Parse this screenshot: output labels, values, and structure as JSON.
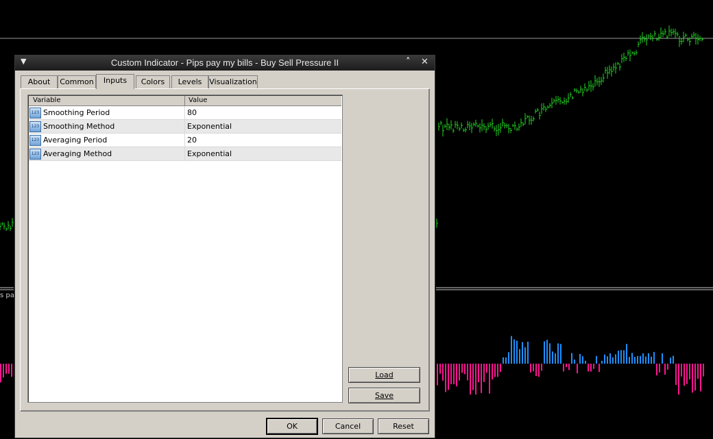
{
  "background": {
    "side_label": "s pay",
    "price_color": "#23d723",
    "up_color": "#1e90ff",
    "down_color": "#ff1493"
  },
  "dialog": {
    "title": "Custom Indicator - Pips pay my bills - Buy Sell Pressure II",
    "menu_icon": "dropdown-arrow-icon",
    "maximize_icon": "chevron-up-icon",
    "close_icon": "close-icon",
    "tabs": [
      {
        "label": "About"
      },
      {
        "label": "Common"
      },
      {
        "label": "Inputs",
        "active": true
      },
      {
        "label": "Colors"
      },
      {
        "label": "Levels"
      },
      {
        "label": "Visualization"
      }
    ],
    "table": {
      "columns": [
        "Variable",
        "Value"
      ],
      "rows": [
        {
          "icon": "123",
          "variable": "Smoothing Period",
          "value": "80"
        },
        {
          "icon": "123",
          "variable": "Smoothing Method",
          "value": "Exponential"
        },
        {
          "icon": "123",
          "variable": "Averaging Period",
          "value": "20"
        },
        {
          "icon": "123",
          "variable": "Averaging Method",
          "value": "Exponential"
        }
      ]
    },
    "load_label": "Load",
    "save_label": "Save",
    "ok_label": "OK",
    "cancel_label": "Cancel",
    "reset_label": "Reset"
  }
}
